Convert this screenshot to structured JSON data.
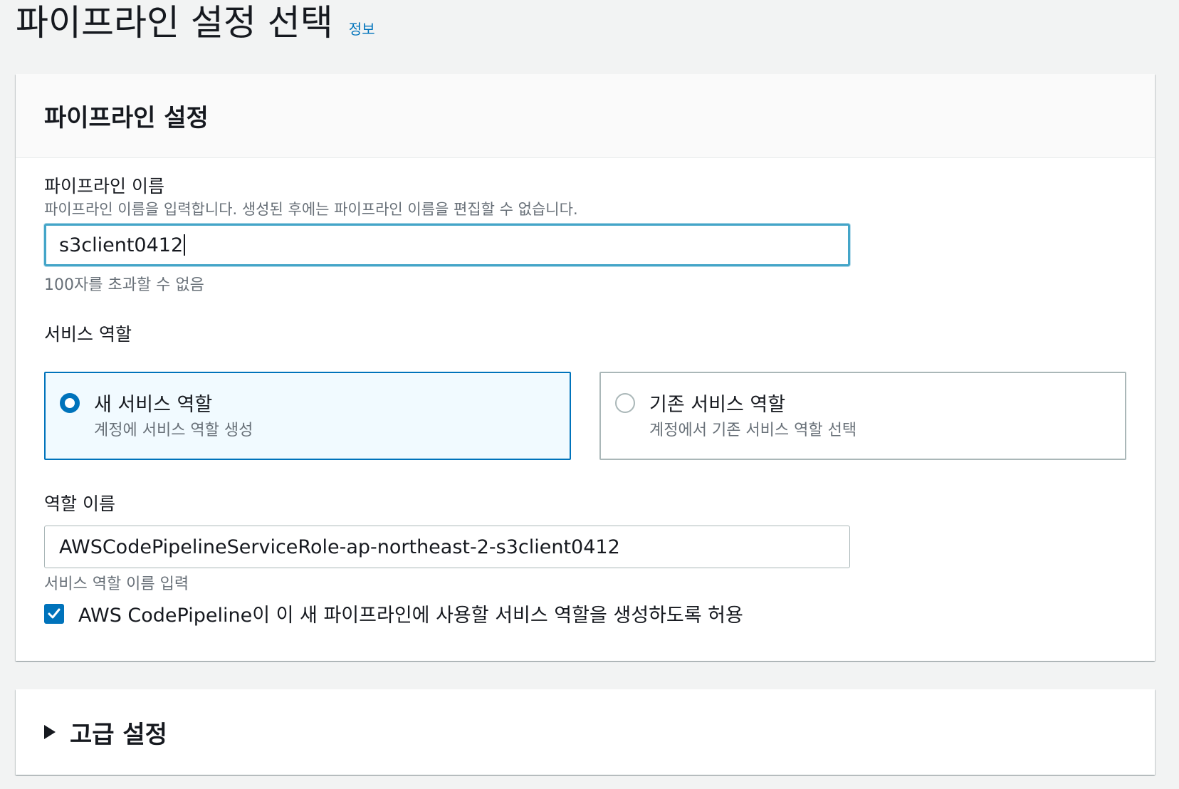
{
  "page": {
    "title": "파이프라인 설정 선택",
    "info_link": "정보"
  },
  "pipeline_settings": {
    "title": "파이프라인 설정",
    "name": {
      "label": "파이프라인 이름",
      "description": "파이프라인 이름을 입력합니다. 생성된 후에는 파이프라인 이름을 편집할 수 없습니다.",
      "value": "s3client0412",
      "constraint": "100자를 초과할 수 없음"
    },
    "service_role": {
      "label": "서비스 역할",
      "options": [
        {
          "title": "새 서비스 역할",
          "description": "계정에 서비스 역할 생성",
          "selected": true
        },
        {
          "title": "기존 서비스 역할",
          "description": "계정에서 기존 서비스 역할 선택",
          "selected": false
        }
      ]
    },
    "role_name": {
      "label": "역할 이름",
      "value": "AWSCodePipelineServiceRole-ap-northeast-2-s3client0412",
      "hint": "서비스 역할 이름 입력"
    },
    "allow_checkbox": {
      "label": "AWS CodePipeline이 이 새 파이프라인에 사용할 서비스 역할을 생성하도록 허용",
      "checked": true
    }
  },
  "advanced": {
    "title": "고급 설정",
    "expanded": false
  },
  "colors": {
    "accent": "#0073bb",
    "focus_ring": "#44a5c8",
    "background": "#f2f3f3"
  }
}
